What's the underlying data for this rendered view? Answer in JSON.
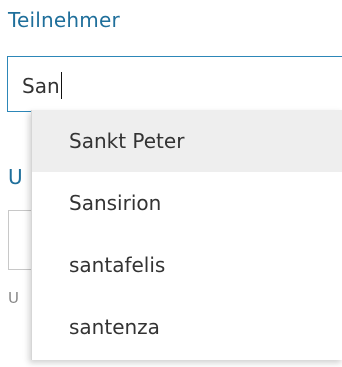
{
  "form": {
    "participant_label": "Teilnehmer",
    "participant_value": "San",
    "next_label_fragment": "U",
    "help_fragment": "U"
  },
  "autocomplete": {
    "items": [
      {
        "label": "Sankt Peter",
        "highlighted": true
      },
      {
        "label": "Sansirion",
        "highlighted": false
      },
      {
        "label": "santafelis",
        "highlighted": false
      },
      {
        "label": "santenza",
        "highlighted": false
      }
    ]
  },
  "colors": {
    "label": "#1f6f9b",
    "input_border": "#2d87b8",
    "highlight": "#eeeeee"
  }
}
